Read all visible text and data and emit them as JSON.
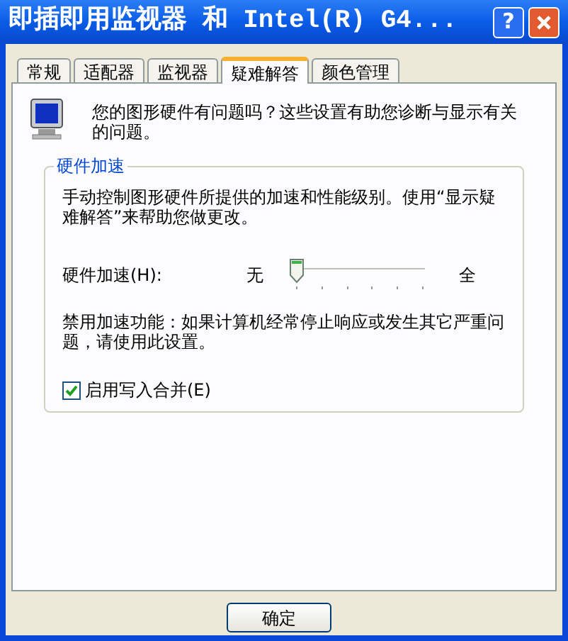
{
  "window": {
    "title": "即插即用监视器 和 Intel(R) G4...",
    "help_button": "?"
  },
  "tabs": [
    {
      "label": "常规",
      "selected": false
    },
    {
      "label": "适配器",
      "selected": false
    },
    {
      "label": "监视器",
      "selected": false
    },
    {
      "label": "疑难解答",
      "selected": true
    },
    {
      "label": "颜色管理",
      "selected": false
    }
  ],
  "intro": "您的图形硬件有问题吗？这些设置有助您诊断与显示有关的问题。",
  "group": {
    "title": "硬件加速",
    "description": "手动控制图形硬件所提供的加速和性能级别。使用“显示疑难解答”来帮助您做更改。",
    "slider": {
      "label": "硬件加速(H):",
      "min_label": "无",
      "max_label": "全",
      "level": 0
    },
    "note": "禁用加速功能：如果计算机经常停止响应或发生其它严重问题，请使用此设置。",
    "checkbox": {
      "label": "启用写入合并(E)",
      "checked": true
    }
  },
  "buttons": [
    {
      "label": "确定"
    }
  ]
}
